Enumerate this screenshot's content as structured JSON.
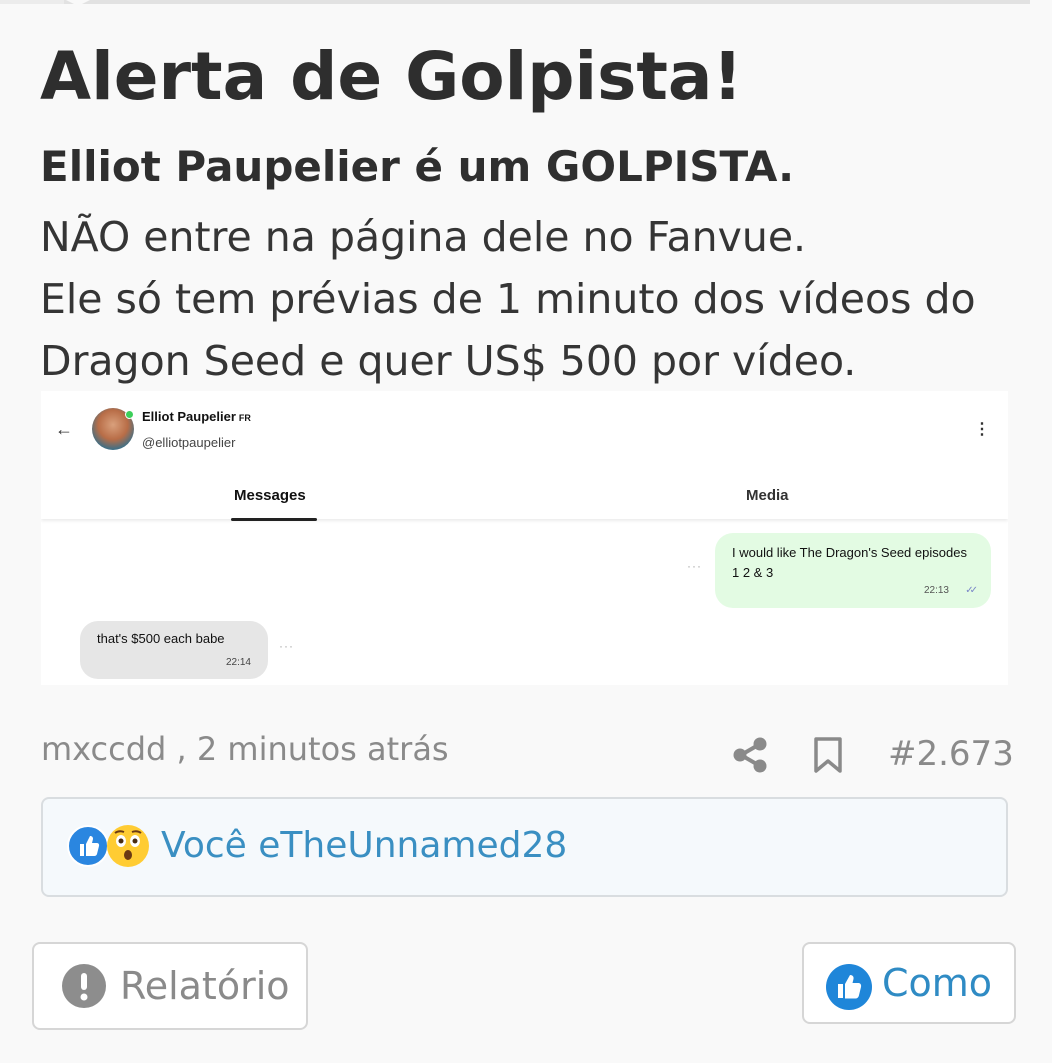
{
  "post": {
    "title": "Alerta de Golpista!",
    "subtitle": "Elliot Paupelier é um GOLPISTA.",
    "body_lines": [
      "NÃO entre na página dele no Fanvue.",
      "Ele só tem prévias de 1 minuto dos vídeos do",
      "Dragon Seed e quer US$ 500 por vídeo."
    ]
  },
  "screenshot": {
    "profile_name": "Elliot Paupelier",
    "profile_flag": "FR",
    "profile_handle": "@elliotpaupelier",
    "tabs": [
      "Messages",
      "Media"
    ],
    "messages": [
      {
        "direction": "outgoing",
        "text": "I would like The Dragon's Seed episodes 1 2 & 3",
        "time": "22:13"
      },
      {
        "direction": "incoming",
        "text": "that's $500 each babe",
        "time": "22:14"
      }
    ]
  },
  "meta": {
    "author_and_time": "mxccdd , 2 minutos atrás",
    "post_number": "#2.673"
  },
  "reactions": {
    "text": "Você eTheUnnamed28",
    "icons": [
      "thumbs-up-icon",
      "astonished-face-icon"
    ]
  },
  "buttons": {
    "report_label": "Relatório",
    "like_label": "Como"
  },
  "colors": {
    "accent": "#2f8bc4",
    "outgoing_bubble": "#e3fbe3",
    "incoming_bubble": "#e6e6e6"
  }
}
